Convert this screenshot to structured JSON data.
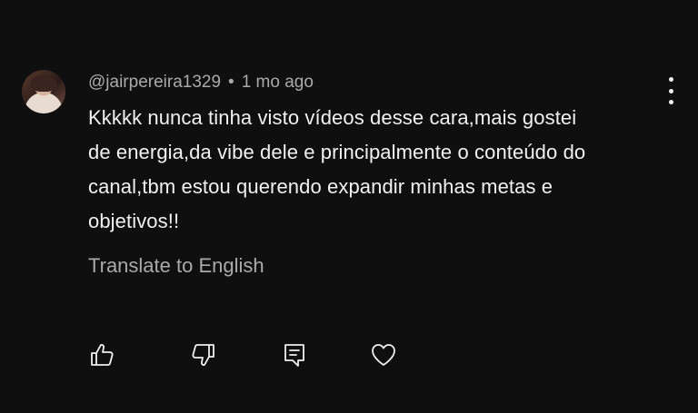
{
  "comment": {
    "author": "@jairpereira1329",
    "separator": "•",
    "timestamp": "1 mo ago",
    "text": "Kkkkk nunca tinha visto vídeos desse cara,mais gostei\nde energia,da vibe dele e principalmente o conteúdo do\ncanal,tbm estou querendo expandir minhas metas e\nobjetivos!!",
    "translate_label": "Translate to English"
  },
  "actions": {
    "like_icon": "thumbs-up-icon",
    "dislike_icon": "thumbs-down-icon",
    "reply_icon": "reply-icon",
    "heart_icon": "heart-icon"
  },
  "colors": {
    "background": "#0f0f0f",
    "primary_text": "#f1f1f1",
    "secondary_text": "#aaaaaa"
  }
}
